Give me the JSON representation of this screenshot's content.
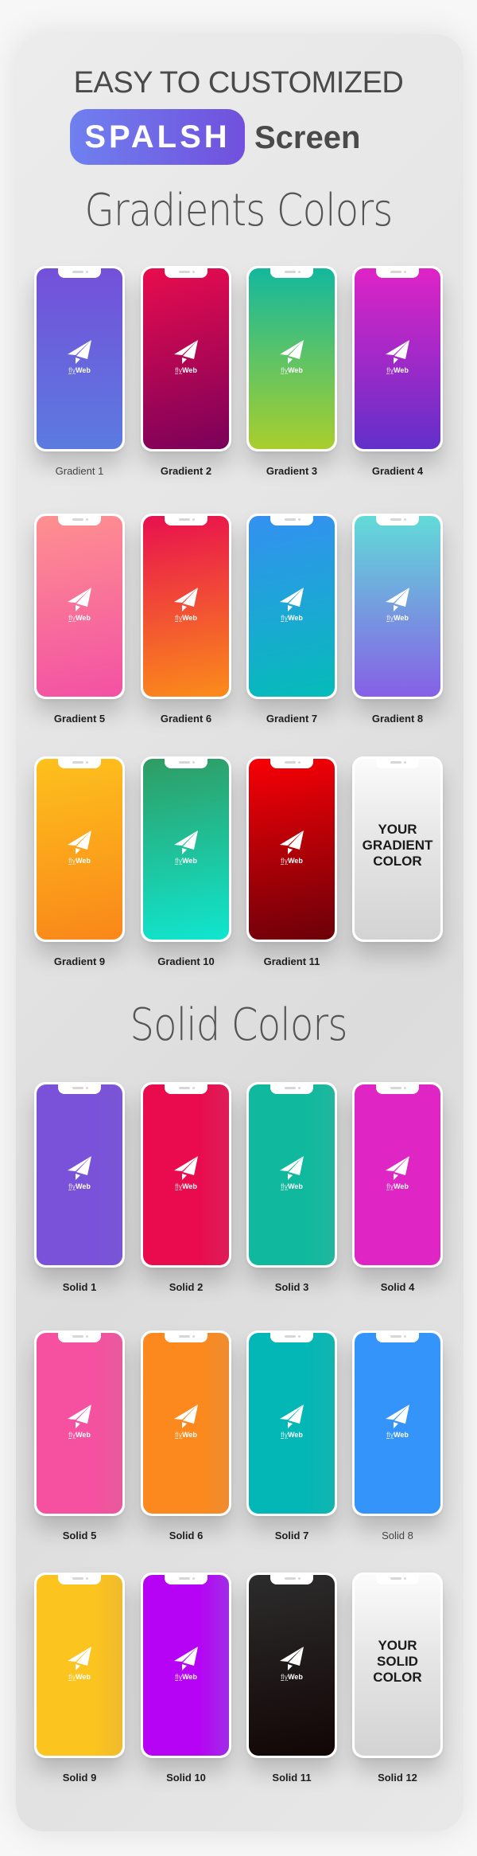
{
  "header": {
    "headline": "EASY TO CUSTOMIZED",
    "pill_label": "SPALSH",
    "pill_tail": "Screen"
  },
  "brand": {
    "logo_fly": "fly",
    "logo_web": "Web",
    "logo_icon": "paper-plane-icon"
  },
  "sections": [
    {
      "title": "Gradients Colors",
      "items": [
        {
          "label": "Gradient 1",
          "type": "gradient",
          "colors": [
            "#7450d9",
            "#5b7be0"
          ],
          "angle": 180
        },
        {
          "label": "Gradient 2",
          "type": "gradient",
          "colors": [
            "#e90c4e",
            "#7a015a"
          ],
          "angle": 165
        },
        {
          "label": "Gradient 3",
          "type": "gradient",
          "colors": [
            "#13b89e",
            "#a9ce2d"
          ],
          "angle": 180
        },
        {
          "label": "Gradient 4",
          "type": "gradient",
          "colors": [
            "#df23c6",
            "#6230c9"
          ],
          "angle": 180
        },
        {
          "label": "Gradient 5",
          "type": "gradient",
          "colors": [
            "#fe9090",
            "#f351a4"
          ],
          "angle": 170
        },
        {
          "label": "Gradient 6",
          "type": "gradient",
          "colors": [
            "#e8104f",
            "#fb8c1a"
          ],
          "angle": 170
        },
        {
          "label": "Gradient 7",
          "type": "gradient",
          "colors": [
            "#3490f2",
            "#05bcb9"
          ],
          "angle": 170
        },
        {
          "label": "Gradient 8",
          "type": "gradient",
          "colors": [
            "#62dbd8",
            "#8660e6"
          ],
          "angle": 180
        },
        {
          "label": "Gradient 9",
          "type": "gradient",
          "colors": [
            "#fdc11c",
            "#fa871a"
          ],
          "angle": 170
        },
        {
          "label": "Gradient 10",
          "type": "gradient",
          "colors": [
            "#2f9c63",
            "#10e6d0"
          ],
          "angle": 170
        },
        {
          "label": "Gradient 11",
          "type": "gradient",
          "colors": [
            "#f70006",
            "#6c0008"
          ],
          "angle": 170
        },
        {
          "label": "",
          "type": "placeholder",
          "placeholder_text": "YOUR GRADIENT COLOR",
          "placeholder_lines": [
            "YOUR",
            "GRADIENT",
            "COLOR"
          ]
        }
      ]
    },
    {
      "title": "Solid Colors",
      "items": [
        {
          "label": "Solid 1",
          "type": "solid",
          "colors": [
            "#7a52d9",
            "#7a55d6"
          ]
        },
        {
          "label": "Solid 2",
          "type": "solid",
          "colors": [
            "#e90b4e",
            "#dd1e58"
          ]
        },
        {
          "label": "Solid 3",
          "type": "solid",
          "colors": [
            "#10b99d",
            "#20b79e"
          ]
        },
        {
          "label": "Solid 4",
          "type": "solid",
          "colors": [
            "#df26c4",
            "#df26c4"
          ]
        },
        {
          "label": "Solid 5",
          "type": "solid",
          "colors": [
            "#f551a0",
            "#e95a9c"
          ]
        },
        {
          "label": "Solid 6",
          "type": "solid",
          "colors": [
            "#fb891d",
            "#ef8c30"
          ]
        },
        {
          "label": "Solid 7",
          "type": "solid",
          "colors": [
            "#03b7b6",
            "#12b5b0"
          ]
        },
        {
          "label": "Solid 8",
          "type": "solid",
          "colors": [
            "#3594f9",
            "#3594f9"
          ],
          "muted": true
        },
        {
          "label": "Solid 9",
          "type": "solid",
          "colors": [
            "#fcc41e",
            "#efbb2c"
          ]
        },
        {
          "label": "Solid 10",
          "type": "solid",
          "colors": [
            "#b603f5",
            "#a02de6"
          ]
        },
        {
          "label": "Solid 11",
          "type": "solid",
          "colors": [
            "#2c2c2c",
            "#120605"
          ]
        },
        {
          "label": "Solid 12",
          "type": "placeholder",
          "placeholder_text": "YOUR SOLID COLOR",
          "placeholder_lines": [
            "YOUR",
            "SOLID",
            "COLOR"
          ]
        }
      ]
    }
  ]
}
